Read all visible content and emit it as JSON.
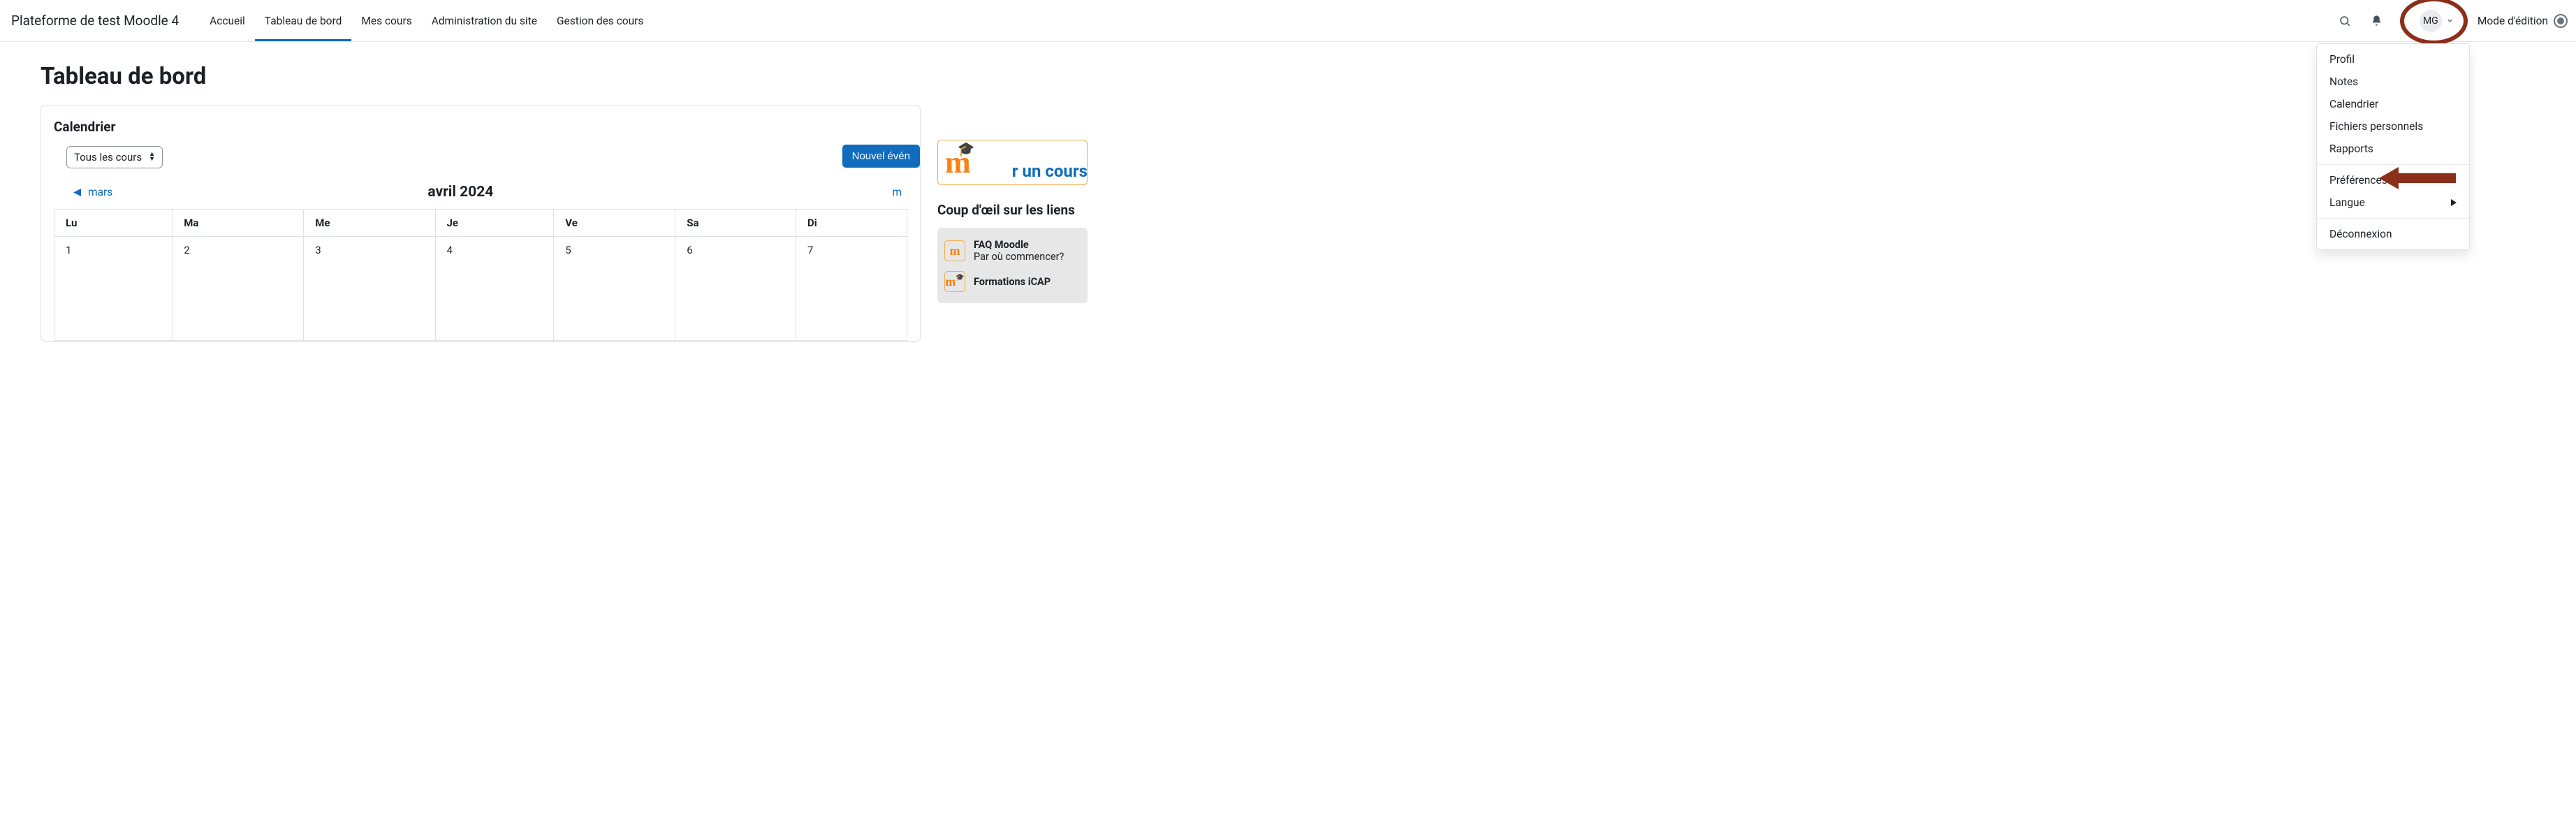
{
  "brand": "Plateforme de test Moodle 4",
  "nav": {
    "accueil": "Accueil",
    "tableau": "Tableau de bord",
    "mescours": "Mes cours",
    "admin": "Administration du site",
    "gestion": "Gestion des cours"
  },
  "user_initials": "MG",
  "edit_mode_label": "Mode d'édition",
  "page_title": "Tableau de bord",
  "calendar": {
    "title": "Calendrier",
    "course_filter": "Tous les cours",
    "prev_month": "mars",
    "current": "avril 2024",
    "next_cut": "m",
    "new_event_cut": "Nouvel évén",
    "days": {
      "lu": "Lu",
      "ma": "Ma",
      "me": "Me",
      "je": "Je",
      "ve": "Ve",
      "sa": "Sa",
      "di": "Di"
    },
    "cells": {
      "d1": "1",
      "d2": "2",
      "d3": "3",
      "d4": "4",
      "d5": "5",
      "d6": "6",
      "d7": "7"
    }
  },
  "menu": {
    "profil": "Profil",
    "notes": "Notes",
    "calendrier": "Calendrier",
    "fichiers": "Fichiers personnels",
    "rapports": "Rapports",
    "preferences": "Préférences",
    "langue": "Langue",
    "deconnexion": "Déconnexion"
  },
  "aside": {
    "cta_cut": "r un cours",
    "links_heading": "Coup d'œil sur les liens",
    "faq_title": "FAQ  Moodle",
    "faq_sub": "Par où commencer?",
    "formations": "Formations iCAP"
  }
}
